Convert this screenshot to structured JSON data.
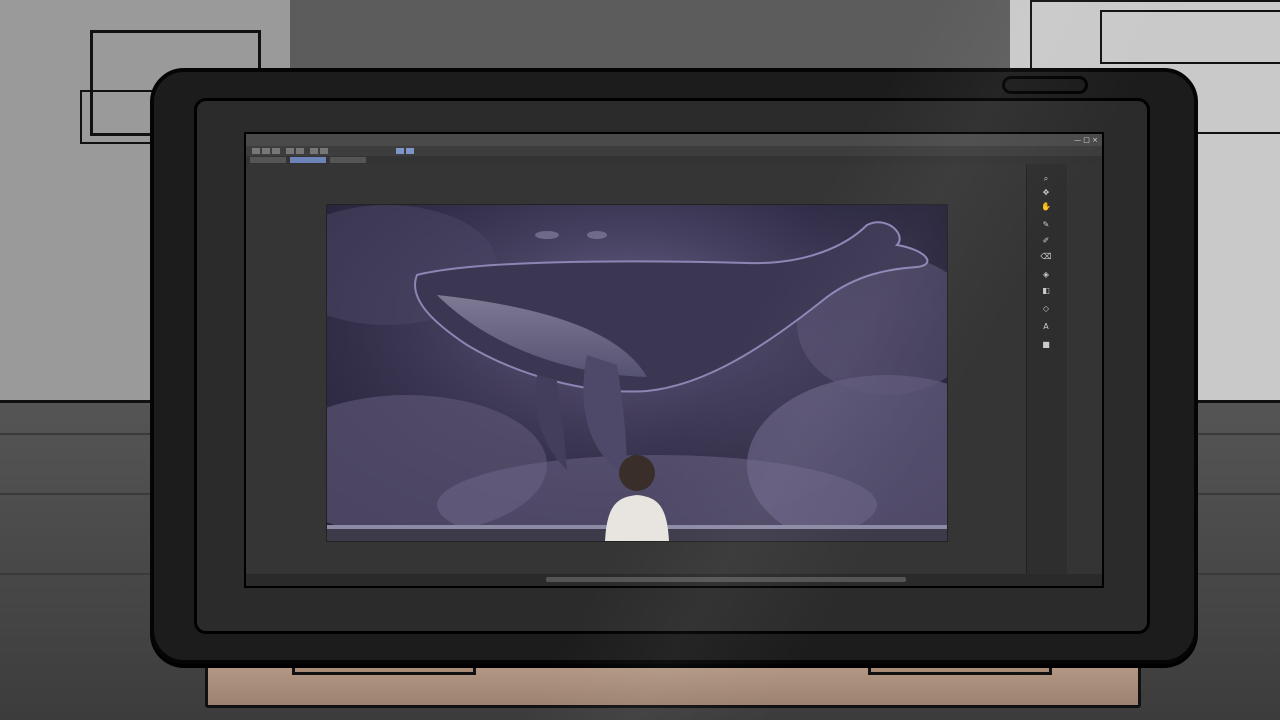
{
  "app": {
    "window_title": "",
    "menu": [],
    "window_controls": "— □ ×"
  },
  "icons": {
    "pen": "pen-icon",
    "eraser": "eraser-icon",
    "brush": "brush-icon",
    "hand": "hand-icon",
    "zoom": "zoom-icon",
    "move": "move-icon",
    "fill": "fill-icon",
    "text": "text-icon",
    "color": "color-swatch-icon"
  },
  "canvas": {
    "subject": ""
  },
  "status": {
    "text": ""
  },
  "colors": {
    "ui_dark": "#343434",
    "accent": "#6e84b8",
    "sky": "#3a3550",
    "whale": "#5a5676",
    "stand_wood": "#b49a86"
  }
}
